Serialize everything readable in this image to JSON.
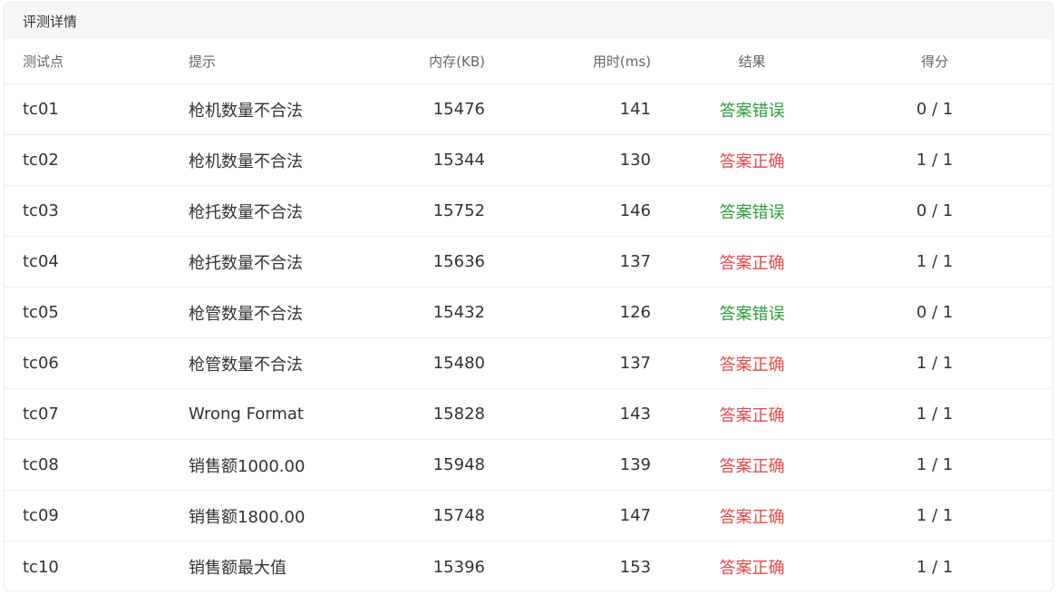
{
  "panel": {
    "title": "评测详情"
  },
  "columns": {
    "id": "测试点",
    "hint": "提示",
    "memory": "内存(KB)",
    "time": "用时(ms)",
    "result": "结果",
    "score": "得分"
  },
  "colors": {
    "wrong_answer": "#2a9d3a",
    "correct_answer": "#e84a4a"
  },
  "rows": [
    {
      "id": "tc01",
      "hint": "枪机数量不合法",
      "memory": "15476",
      "time": "141",
      "result": "答案错误",
      "status": "wrong",
      "score": "0 / 1"
    },
    {
      "id": "tc02",
      "hint": "枪机数量不合法",
      "memory": "15344",
      "time": "130",
      "result": "答案正确",
      "status": "right",
      "score": "1 / 1"
    },
    {
      "id": "tc03",
      "hint": "枪托数量不合法",
      "memory": "15752",
      "time": "146",
      "result": "答案错误",
      "status": "wrong",
      "score": "0 / 1"
    },
    {
      "id": "tc04",
      "hint": "枪托数量不合法",
      "memory": "15636",
      "time": "137",
      "result": "答案正确",
      "status": "right",
      "score": "1 / 1"
    },
    {
      "id": "tc05",
      "hint": "枪管数量不合法",
      "memory": "15432",
      "time": "126",
      "result": "答案错误",
      "status": "wrong",
      "score": "0 / 1"
    },
    {
      "id": "tc06",
      "hint": "枪管数量不合法",
      "memory": "15480",
      "time": "137",
      "result": "答案正确",
      "status": "right",
      "score": "1 / 1"
    },
    {
      "id": "tc07",
      "hint": "Wrong Format",
      "memory": "15828",
      "time": "143",
      "result": "答案正确",
      "status": "right",
      "score": "1 / 1"
    },
    {
      "id": "tc08",
      "hint": "销售额1000.00",
      "memory": "15948",
      "time": "139",
      "result": "答案正确",
      "status": "right",
      "score": "1 / 1"
    },
    {
      "id": "tc09",
      "hint": "销售额1800.00",
      "memory": "15748",
      "time": "147",
      "result": "答案正确",
      "status": "right",
      "score": "1 / 1"
    },
    {
      "id": "tc10",
      "hint": "销售额最大值",
      "memory": "15396",
      "time": "153",
      "result": "答案正确",
      "status": "right",
      "score": "1 / 1"
    }
  ]
}
